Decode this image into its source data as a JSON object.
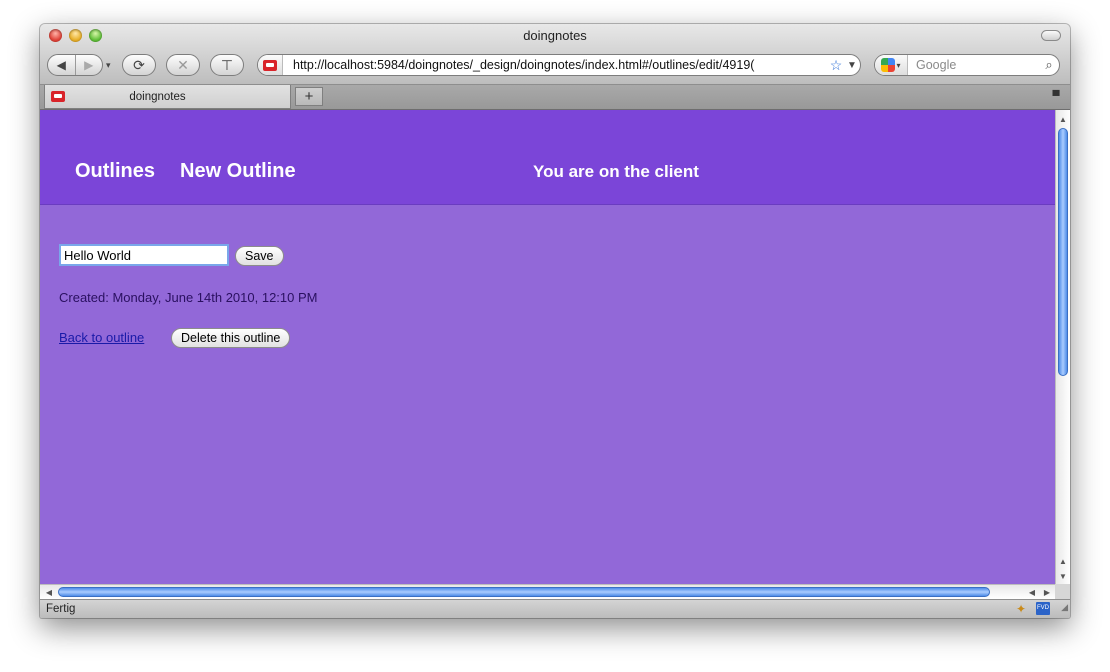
{
  "window": {
    "title": "doingnotes"
  },
  "toolbar": {
    "back_icon": "◀",
    "forward_icon": "▶",
    "history_icon": "▾",
    "reload_icon": "⟳",
    "stop_icon": "✕",
    "bookmark_icon": "⊤"
  },
  "url_bar": {
    "url": "http://localhost:5984/doingnotes/_design/doingnotes/index.html#/outlines/edit/4919(",
    "star_icon": "☆",
    "dropdown_icon": "▼"
  },
  "search_bar": {
    "placeholder": "Google",
    "magnifier_icon": "⌕"
  },
  "tabs": [
    {
      "label": "doingnotes"
    }
  ],
  "tab_bar": {
    "new_tab_label": "+",
    "menu_icon": "▀"
  },
  "page": {
    "nav": {
      "outlines": "Outlines",
      "new_outline": "New Outline"
    },
    "header_message": "You are on the client",
    "title_input_value": "Hello World",
    "save_label": "Save",
    "created_text": "Created: Monday, June 14th 2010, 12:10 PM",
    "back_link": "Back to outline",
    "delete_label": "Delete this outline",
    "colors": {
      "header_bg": "#7b45d8",
      "page_bg": "#9268d8",
      "text_white": "#ffffff",
      "link_blue": "#1a1aa8"
    }
  },
  "scrollbars": {
    "up_icon": "▲",
    "down_icon": "▼",
    "left_icon": "◀",
    "right_icon": "▶"
  },
  "status_bar": {
    "text": "Fertig",
    "addon2_label": "FVD",
    "grip_icon": "◢"
  }
}
